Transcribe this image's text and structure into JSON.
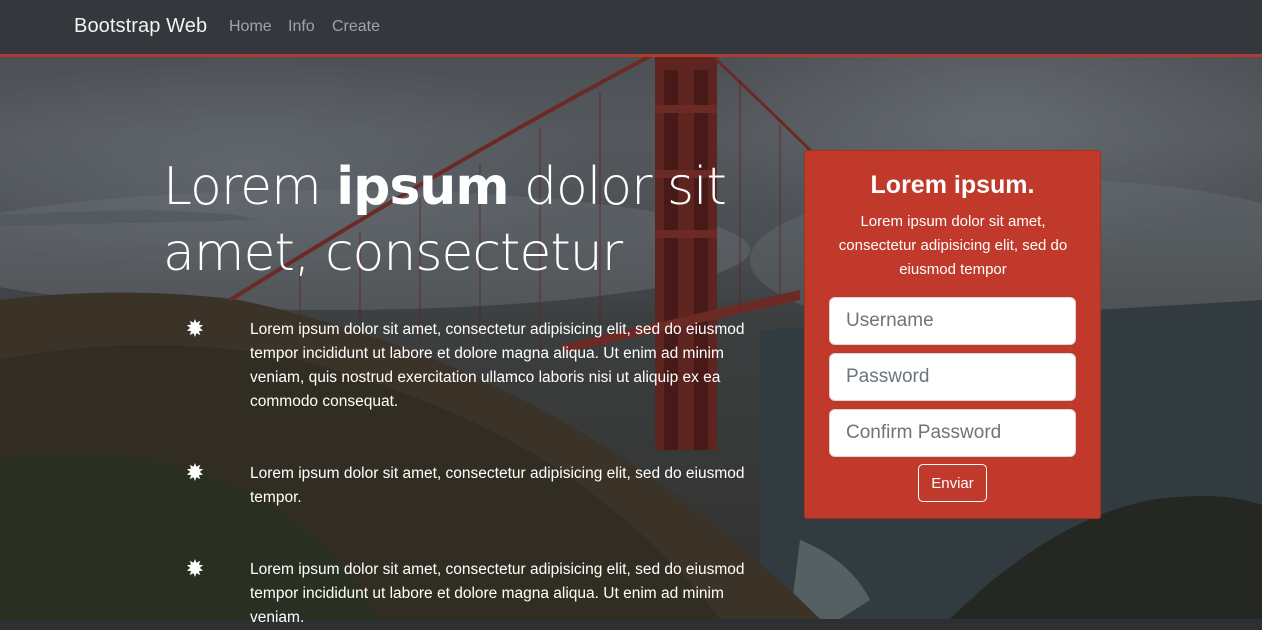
{
  "navbar": {
    "brand": "Bootstrap Web",
    "links": [
      "Home",
      "Info",
      "Create"
    ]
  },
  "hero": {
    "headline_part1": "Lorem ",
    "headline_bold": "ipsum",
    "headline_part2": " dolor sit amet, consectetur",
    "features": [
      "Lorem ipsum dolor sit amet, consectetur adipisicing elit, sed do eiusmod tempor incididunt ut labore et dolore magna aliqua. Ut enim ad minim veniam, quis nostrud exercitation ullamco laboris nisi ut aliquip ex ea commodo consequat.",
      "Lorem ipsum dolor sit amet, consectetur adipisicing elit, sed do eiusmod tempor.",
      "Lorem ipsum dolor sit amet, consectetur adipisicing elit, sed do eiusmod tempor incididunt ut labore et dolore magna aliqua. Ut enim ad minim veniam."
    ],
    "bullet_icon": "burst-icon"
  },
  "form": {
    "title": "Lorem ipsum.",
    "subtitle": "Lorem ipsum dolor sit amet, consectetur adipisicing elit, sed do eiusmod tempor",
    "username_placeholder": "Username",
    "password_placeholder": "Password",
    "confirm_placeholder": "Confirm Password",
    "submit_label": "Enviar"
  },
  "colors": {
    "navbar_bg": "#34383d",
    "accent": "#c0392b",
    "text": "#ffffff"
  }
}
